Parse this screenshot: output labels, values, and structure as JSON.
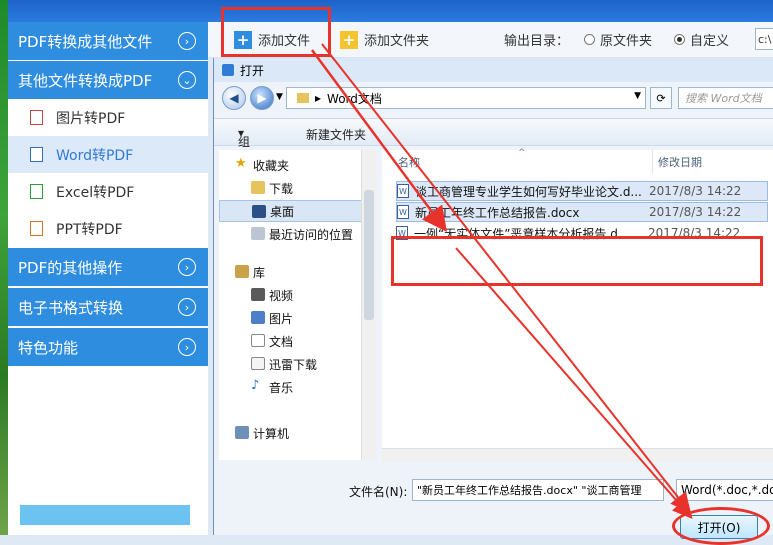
{
  "sidebar": {
    "sec1": "PDF转换成其他文件",
    "sec2": "其他文件转换成PDF",
    "items": [
      "图片转PDF",
      "Word转PDF",
      "Excel转PDF",
      "PPT转PDF"
    ],
    "sec3": "PDF的其他操作",
    "sec4": "电子书格式转换",
    "sec5": "特色功能"
  },
  "toolbar": {
    "add_file": "添加文件",
    "add_folder": "添加文件夹",
    "output_label": "输出目录：",
    "opt_source": "原文件夹",
    "opt_custom": "自定义",
    "path": "c:\\"
  },
  "dialog": {
    "title": "打开",
    "address": "Word文档",
    "search_placeholder": "搜索 Word文档",
    "organize": "组织",
    "new_folder": "新建文件夹",
    "nav": {
      "favorites": "收藏夹",
      "downloads": "下载",
      "desktop": "桌面",
      "recent": "最近访问的位置",
      "libraries": "库",
      "videos": "视频",
      "pictures": "图片",
      "documents": "文档",
      "thunder": "迅雷下载",
      "music": "音乐",
      "computer": "计算机"
    },
    "col_name": "名称",
    "col_date": "修改日期",
    "files": [
      {
        "name": "谈工商管理专业学生如何写好毕业论文.d...",
        "date": "2017/8/3 14:22"
      },
      {
        "name": "新员工年终工作总结报告.docx",
        "date": "2017/8/3 14:22"
      },
      {
        "name": "一例“无实体文件”恶意样本分析报告.d...",
        "date": "2017/8/3 14:22"
      }
    ],
    "filename_label": "文件名(N):",
    "filename_value": "\"新员工年终工作总结报告.docx\" \"谈工商管理",
    "filetype": "Word(*.doc,*.docx)",
    "open_button": "打开(O)"
  }
}
